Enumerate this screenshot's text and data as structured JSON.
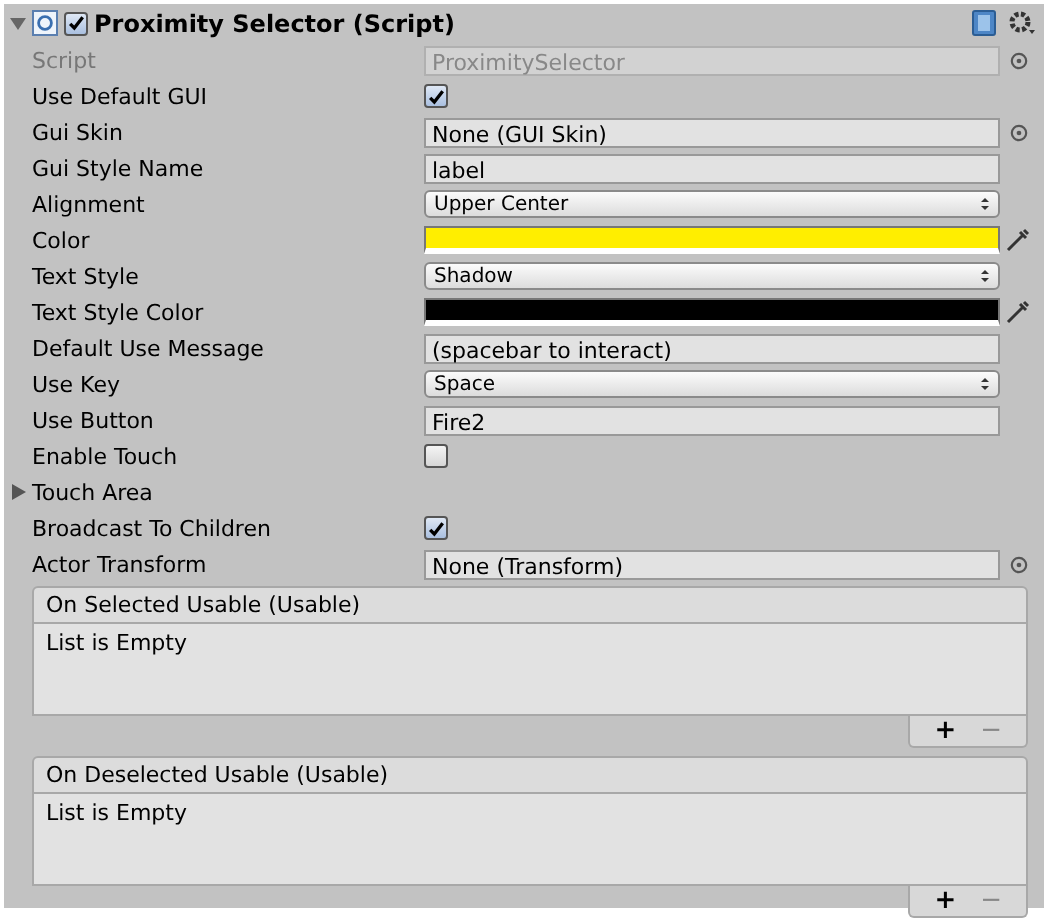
{
  "component": {
    "title": "Proximity Selector (Script)",
    "expanded": true,
    "enabled": true
  },
  "properties": [
    {
      "kind": "object",
      "label": "Script",
      "value": "ProximitySelector",
      "disabled": true
    },
    {
      "kind": "checkbox",
      "label": "Use Default GUI",
      "checked": true
    },
    {
      "kind": "object",
      "label": "Gui Skin",
      "value": "None (GUI Skin)",
      "disabled": false
    },
    {
      "kind": "text",
      "label": "Gui Style Name",
      "value": "label"
    },
    {
      "kind": "popup",
      "label": "Alignment",
      "value": "Upper Center"
    },
    {
      "kind": "color",
      "label": "Color",
      "color": "#ffee00"
    },
    {
      "kind": "popup",
      "label": "Text Style",
      "value": "Shadow"
    },
    {
      "kind": "color",
      "label": "Text Style Color",
      "color": "#000000"
    },
    {
      "kind": "text",
      "label": "Default Use Message",
      "value": "(spacebar to interact)"
    },
    {
      "kind": "popup",
      "label": "Use Key",
      "value": "Space"
    },
    {
      "kind": "text",
      "label": "Use Button",
      "value": "Fire2"
    },
    {
      "kind": "checkbox",
      "label": "Enable Touch",
      "checked": false
    },
    {
      "kind": "foldout",
      "label": "Touch Area",
      "expanded": false
    },
    {
      "kind": "checkbox",
      "label": "Broadcast To Children",
      "checked": true
    },
    {
      "kind": "object",
      "label": "Actor Transform",
      "value": "None (Transform)",
      "disabled": false
    }
  ],
  "events": [
    {
      "title": "On Selected Usable (Usable)",
      "empty_text": "List is Empty",
      "add": "+",
      "remove": "−"
    },
    {
      "title": "On Deselected Usable (Usable)",
      "empty_text": "List is Empty",
      "add": "+",
      "remove": "−"
    }
  ]
}
